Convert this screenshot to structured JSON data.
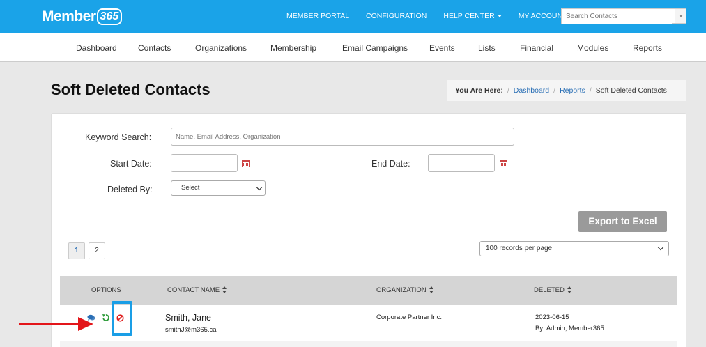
{
  "app": {
    "logo_text": "Member",
    "logo_number": "365"
  },
  "topnav": {
    "items": [
      {
        "label": "MEMBER PORTAL",
        "dropdown": false
      },
      {
        "label": "CONFIGURATION",
        "dropdown": false
      },
      {
        "label": "HELP CENTER",
        "dropdown": true
      },
      {
        "label": "MY ACCOUNT",
        "dropdown": true
      }
    ],
    "search_placeholder": "Search Contacts"
  },
  "subnav": {
    "items": [
      "Dashboard",
      "Contacts",
      "Organizations",
      "Membership",
      "Email Campaigns",
      "Events",
      "Lists",
      "Financial",
      "Modules",
      "Reports"
    ]
  },
  "page": {
    "title": "Soft Deleted Contacts"
  },
  "breadcrumb": {
    "prefix": "You Are Here:",
    "items": [
      "Dashboard",
      "Reports"
    ],
    "current": "Soft Deleted Contacts"
  },
  "filters": {
    "keyword_label": "Keyword Search:",
    "keyword_placeholder": "Name, Email Address, Organization",
    "start_label": "Start Date:",
    "end_label": "End Date:",
    "deleted_by_label": "Deleted By:",
    "deleted_by_value": "Select"
  },
  "actions": {
    "export_label": "Export to Excel"
  },
  "pagination": {
    "pages": [
      "1",
      "2"
    ],
    "active_page": "1",
    "records_per_page": "100 records per page"
  },
  "table": {
    "headers": {
      "options": "OPTIONS",
      "contact_name": "CONTACT NAME",
      "organization": "ORGANIZATION",
      "deleted": "DELETED"
    },
    "rows": [
      {
        "name": "Smith, Jane",
        "email": "smithJ@m365.ca",
        "organization": "Corporate Partner Inc.",
        "deleted_date": "2023-06-15",
        "deleted_by": "By: Admin, Member365"
      }
    ]
  },
  "colors": {
    "brand": "#1aa3e8",
    "highlight": "#1a9ee6",
    "arrow": "#e3151a",
    "restore": "#2e9c3a",
    "delete": "#e02020",
    "comment": "#2a6fb5"
  },
  "icons": {
    "comment": "comment-icon",
    "restore": "restore-icon",
    "delete": "ban-icon",
    "calendar": "calendar-icon"
  }
}
